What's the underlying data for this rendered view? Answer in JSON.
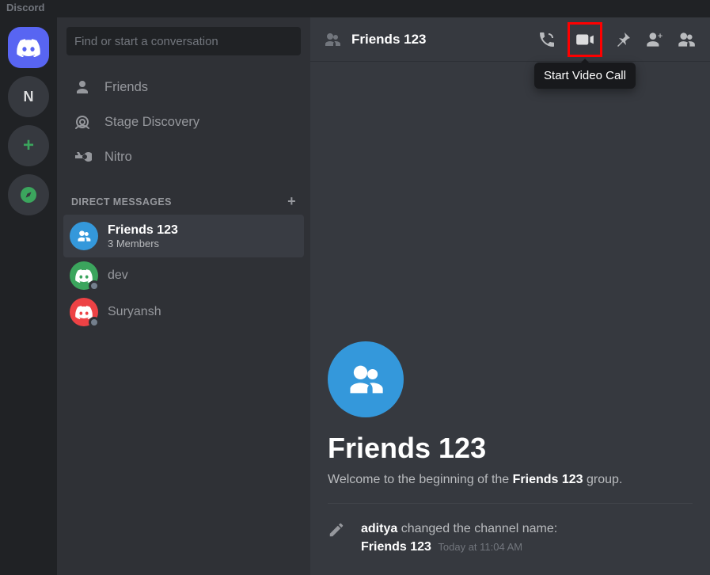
{
  "window": {
    "title": "Discord"
  },
  "guild_rail": {
    "server_letter": "N"
  },
  "sidebar": {
    "search_placeholder": "Find or start a conversation",
    "nav": {
      "friends": "Friends",
      "stage": "Stage Discovery",
      "nitro": "Nitro"
    },
    "section_label": "DIRECT MESSAGES",
    "dms": [
      {
        "name": "Friends 123",
        "subtitle": "3 Members",
        "avatar_color": "blue",
        "selected": true,
        "group": true
      },
      {
        "name": "dev",
        "avatar_color": "green",
        "selected": false,
        "group": false
      },
      {
        "name": "Suryansh",
        "avatar_color": "red",
        "selected": false,
        "group": false
      }
    ]
  },
  "chat": {
    "title": "Friends 123",
    "tooltip": "Start Video Call",
    "welcome": {
      "title": "Friends 123",
      "pre": "Welcome to the beginning of the ",
      "name": "Friends 123",
      "post": " group."
    },
    "system_message": {
      "actor": "aditya",
      "action": "changed the channel name:",
      "new_name": "Friends 123",
      "timestamp": "Today at 11:04 AM"
    }
  }
}
